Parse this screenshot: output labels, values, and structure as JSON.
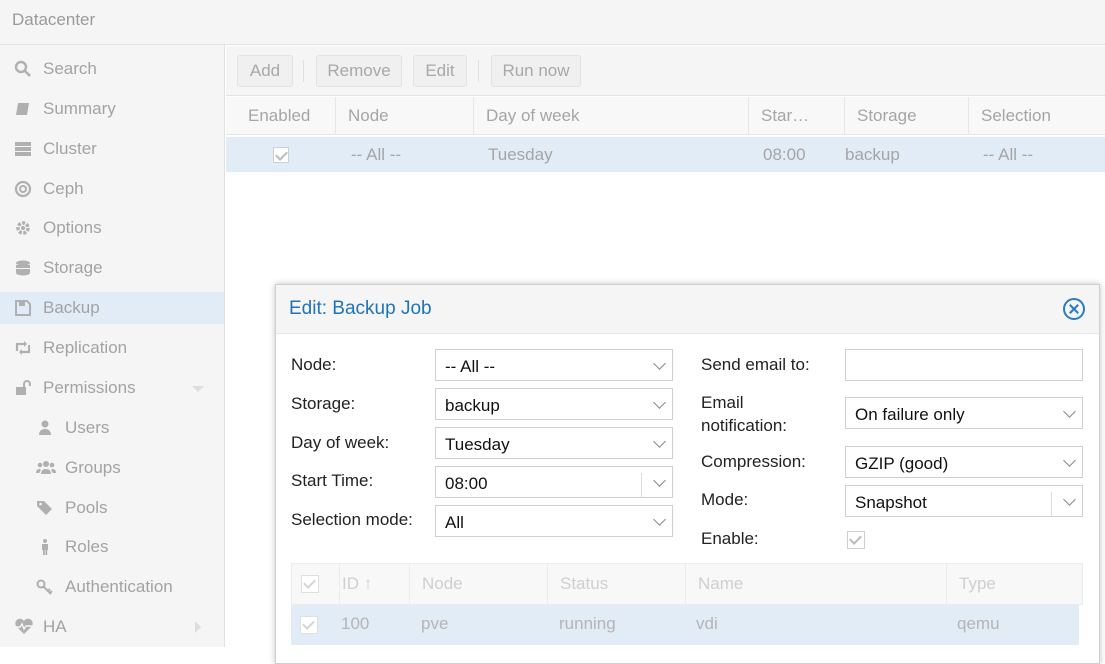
{
  "datacenter_title": "Datacenter",
  "nav": {
    "items": [
      {
        "label": "Search",
        "icon": "search-icon"
      },
      {
        "label": "Summary",
        "icon": "book-icon"
      },
      {
        "label": "Cluster",
        "icon": "server-icon"
      },
      {
        "label": "Ceph",
        "icon": "ceph-icon"
      },
      {
        "label": "Options",
        "icon": "gear-icon"
      },
      {
        "label": "Storage",
        "icon": "database-icon"
      },
      {
        "label": "Backup",
        "icon": "floppy-icon"
      },
      {
        "label": "Replication",
        "icon": "retweet-icon"
      },
      {
        "label": "Permissions",
        "icon": "unlock-icon"
      },
      {
        "label": "Users",
        "icon": "user-icon"
      },
      {
        "label": "Groups",
        "icon": "users-icon"
      },
      {
        "label": "Pools",
        "icon": "tags-icon"
      },
      {
        "label": "Roles",
        "icon": "male-icon"
      },
      {
        "label": "Authentication",
        "icon": "key-icon"
      },
      {
        "label": "HA",
        "icon": "heartbeat-icon"
      }
    ],
    "selected": "Backup"
  },
  "toolbar": {
    "add": "Add",
    "remove": "Remove",
    "edit": "Edit",
    "run_now": "Run now"
  },
  "grid": {
    "columns": [
      "Enabled",
      "Node",
      "Day of week",
      "Star…",
      "Storage",
      "Selection"
    ],
    "rows": [
      {
        "enabled": true,
        "node": "-- All --",
        "day": "Tuesday",
        "start": "08:00",
        "storage": "backup",
        "selection": "-- All --"
      }
    ]
  },
  "dialog": {
    "title": "Edit: Backup Job",
    "fields": {
      "node_label": "Node:",
      "node_value": "-- All --",
      "storage_label": "Storage:",
      "storage_value": "backup",
      "dow_label": "Day of week:",
      "dow_value": "Tuesday",
      "start_label": "Start Time:",
      "start_value": "08:00",
      "selmode_label": "Selection mode:",
      "selmode_value": "All",
      "email_label": "Send email to:",
      "email_value": "",
      "notify_label_1": "Email",
      "notify_label_2": "notification:",
      "notify_value": "On failure only",
      "compression_label": "Compression:",
      "compression_value": "GZIP (good)",
      "mode_label": "Mode:",
      "mode_value": "Snapshot",
      "enable_label": "Enable:",
      "enable_checked": true
    },
    "vm_grid": {
      "columns": [
        "ID ↑",
        "Node",
        "Status",
        "Name",
        "Type"
      ],
      "rows": [
        {
          "checked": true,
          "id": "100",
          "node": "pve",
          "status": "running",
          "name": "vdi",
          "type": "qemu"
        }
      ]
    }
  },
  "colors": {
    "accent": "#1f73b7",
    "selection": "#e2ecf7"
  }
}
